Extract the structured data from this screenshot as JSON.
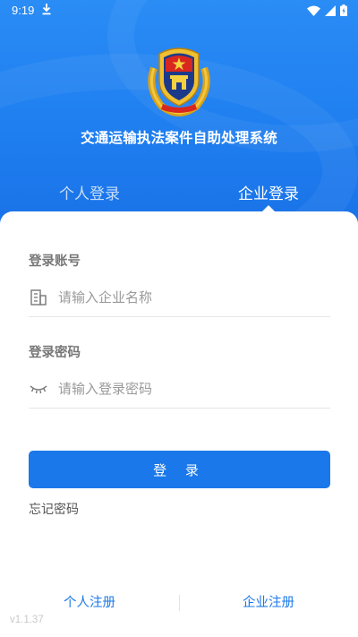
{
  "status_bar": {
    "time": "9:19",
    "icons": [
      "download-icon",
      "wifi-icon",
      "signal-icon",
      "battery-icon"
    ]
  },
  "header": {
    "emblem": "police-emblem",
    "title": "交通运输执法案件自助处理系统"
  },
  "tabs": [
    {
      "label": "个人登录",
      "active": false
    },
    {
      "label": "企业登录",
      "active": true
    }
  ],
  "form": {
    "account_label": "登录账号",
    "account_placeholder": "请输入企业名称",
    "account_icon": "building-icon",
    "password_label": "登录密码",
    "password_placeholder": "请输入登录密码",
    "password_icon": "eye-closed-icon",
    "login_button": "登 录",
    "forgot_password": "忘记密码"
  },
  "footer": {
    "personal_register": "个人注册",
    "enterprise_register": "企业注册",
    "version": "v1.1.37"
  },
  "colors": {
    "primary": "#1b78ea",
    "header_top": "#2a8cf5",
    "label": "#777777"
  }
}
